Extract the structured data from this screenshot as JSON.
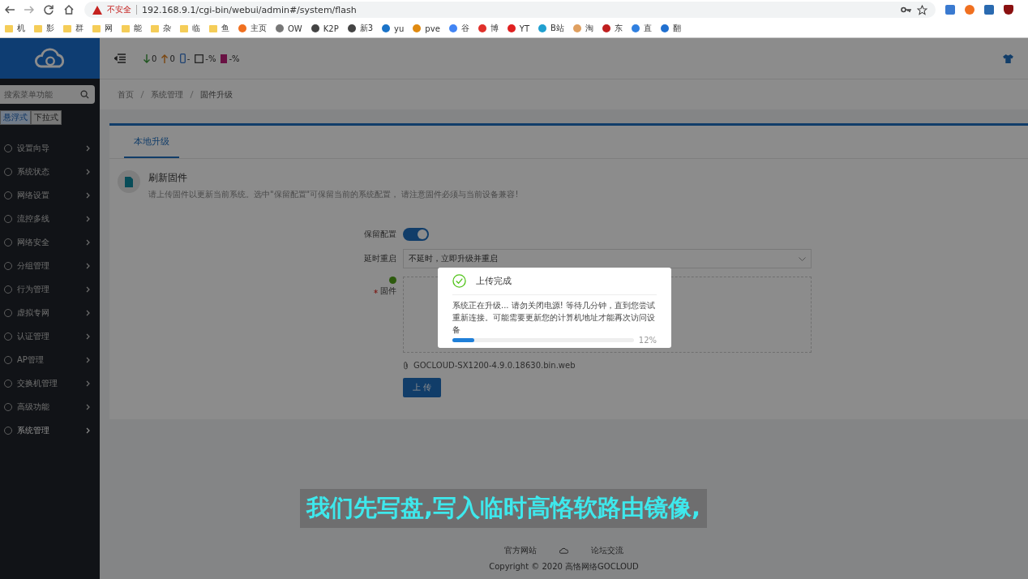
{
  "browser": {
    "security_label": "不安全",
    "url": "192.168.9.1/cgi-bin/webui/admin#/system/flash",
    "bookmarks": [
      {
        "kind": "folder",
        "label": "机"
      },
      {
        "kind": "folder",
        "label": "影"
      },
      {
        "kind": "folder",
        "label": "群"
      },
      {
        "kind": "folder",
        "label": "网"
      },
      {
        "kind": "folder",
        "label": "能"
      },
      {
        "kind": "folder",
        "label": "杂"
      },
      {
        "kind": "folder",
        "label": "临"
      },
      {
        "kind": "folder",
        "label": "鱼"
      },
      {
        "kind": "site",
        "label": "主页",
        "color": "#f07020"
      },
      {
        "kind": "site",
        "label": "OW",
        "color": "#777777"
      },
      {
        "kind": "site",
        "label": "K2P",
        "color": "#444444"
      },
      {
        "kind": "site",
        "label": "新3",
        "color": "#444444"
      },
      {
        "kind": "site",
        "label": "yu",
        "color": "#1a73c8"
      },
      {
        "kind": "site",
        "label": "pve",
        "color": "#e08a10"
      },
      {
        "kind": "site",
        "label": "谷",
        "color": "#4285f4"
      },
      {
        "kind": "site",
        "label": "博",
        "color": "#e0302a"
      },
      {
        "kind": "site",
        "label": "YT",
        "color": "#e02020"
      },
      {
        "kind": "site",
        "label": "B站",
        "color": "#20a0d0"
      },
      {
        "kind": "site",
        "label": "淘",
        "color": "#e0a060"
      },
      {
        "kind": "site",
        "label": "东",
        "color": "#c02020"
      },
      {
        "kind": "site",
        "label": "直",
        "color": "#3080e0"
      },
      {
        "kind": "site",
        "label": "翻",
        "color": "#2070d0"
      }
    ]
  },
  "sidebar": {
    "search": {
      "placeholder": "搜索菜单功能"
    },
    "modes": [
      {
        "label": "悬浮式",
        "selected": true
      },
      {
        "label": "下拉式",
        "selected": false
      }
    ],
    "items": [
      {
        "label": "设置向导",
        "selected": false
      },
      {
        "label": "系统状态",
        "selected": false
      },
      {
        "label": "网络设置",
        "selected": false
      },
      {
        "label": "流控多线",
        "selected": false
      },
      {
        "label": "网络安全",
        "selected": false
      },
      {
        "label": "分组管理",
        "selected": false
      },
      {
        "label": "行为管理",
        "selected": false
      },
      {
        "label": "虚拟专网",
        "selected": false
      },
      {
        "label": "认证管理",
        "selected": false
      },
      {
        "label": "AP管理",
        "selected": false
      },
      {
        "label": "交换机管理",
        "selected": false
      },
      {
        "label": "高级功能",
        "selected": false
      },
      {
        "label": "系统管理",
        "selected": true
      }
    ]
  },
  "header": {
    "stats": [
      {
        "kind": "down",
        "text": "0"
      },
      {
        "kind": "up",
        "text": "0"
      },
      {
        "kind": "phone",
        "text": "-"
      },
      {
        "kind": "square",
        "text": "-%"
      },
      {
        "kind": "battery",
        "text": "-%"
      }
    ]
  },
  "breadcrumb": [
    "首页",
    "系统管理",
    "固件升级"
  ],
  "tabs": [
    {
      "label": "本地升级",
      "selected": true
    }
  ],
  "section": {
    "title": "刷新固件",
    "description": "请上传固件以更新当前系统。选中\"保留配置\"可保留当前的系统配置，  请注意固件必须与当前设备兼容!"
  },
  "form": {
    "keep_config": {
      "label": "保留配置",
      "on": true
    },
    "delay": {
      "label": "延时重启",
      "value": "不延时，立即升级并重启"
    },
    "firmware": {
      "label": "固件",
      "required": true,
      "file": "GOCLOUD-SX1200-4.9.0.18630.bin.web"
    },
    "upload_button": "上 传"
  },
  "dialog": {
    "title": "上传完成",
    "message": "系统正在升级... 请勿关闭电源! 等待几分钟，直到您尝试重新连接。可能需要更新您的计算机地址才能再次访问设备",
    "level": 0.12,
    "reading": "12%"
  },
  "footer": {
    "links": [
      "官方网站",
      "论坛交流"
    ],
    "copyright": "Copyright © 2020 高恪网络GOCLOUD"
  },
  "subtitle": "我们先写盘,写入临时高恪软路由镜像,"
}
